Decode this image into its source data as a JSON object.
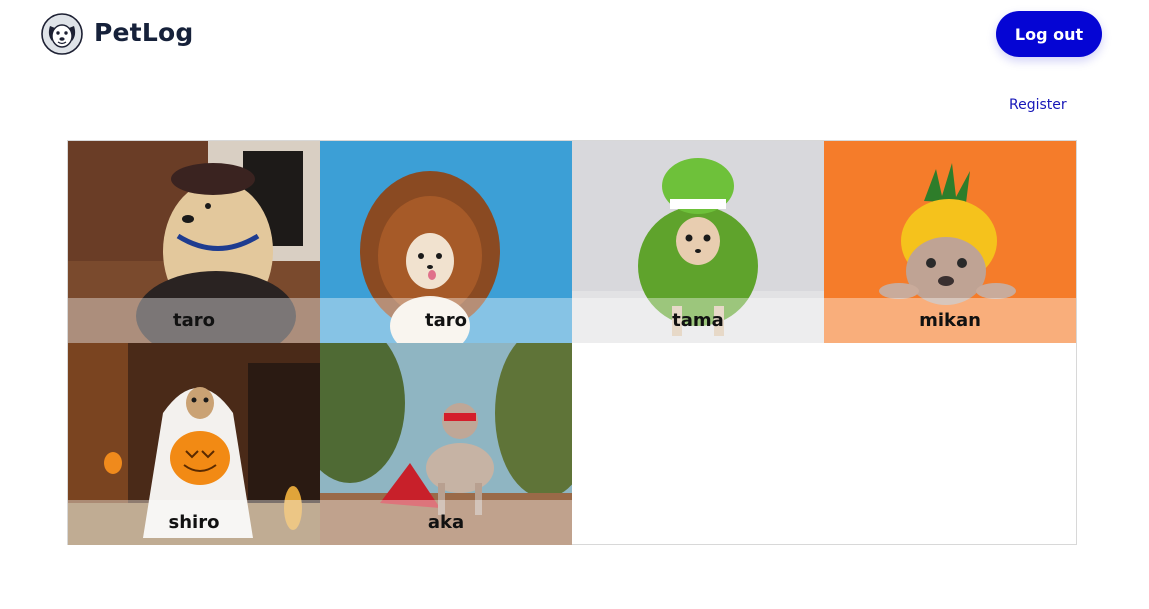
{
  "header": {
    "brand": "PetLog",
    "logout_label": "Log out",
    "register_label": "Register"
  },
  "pets": [
    {
      "name": "taro",
      "photo": "dog-in-delivery-uniform"
    },
    {
      "name": "taro",
      "photo": "chihuahua-in-lion-mane"
    },
    {
      "name": "tama",
      "photo": "chihuahua-in-dinosaur-costume"
    },
    {
      "name": "mikan",
      "photo": "bulldog-in-pineapple-costume"
    },
    {
      "name": "shiro",
      "photo": "dog-in-ghost-costume-with-pumpkin"
    },
    {
      "name": "aka",
      "photo": "bulldog-in-superhero-cape"
    }
  ],
  "colors": {
    "accent": "#0505d4",
    "link": "#1717b8"
  }
}
